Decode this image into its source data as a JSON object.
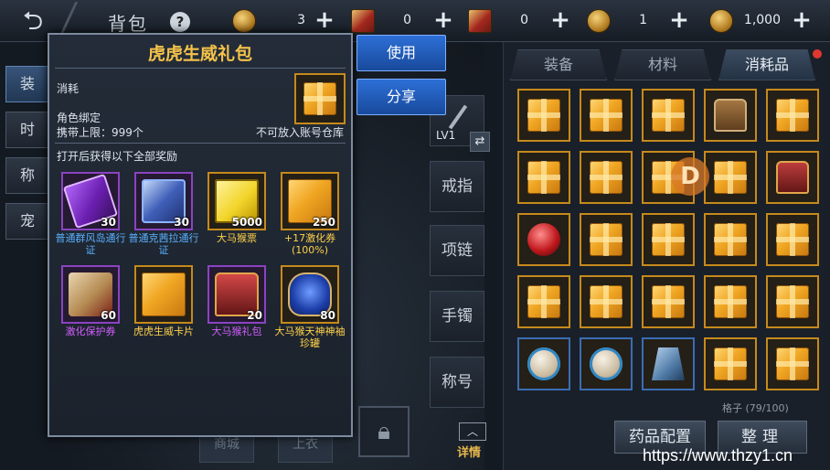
{
  "header": {
    "back_icon": "back-arrow-icon",
    "title": "背包",
    "help": "?",
    "currencies": [
      {
        "icon": "gold-coin-icon",
        "value": "3"
      },
      {
        "icon": "red-scroll-icon",
        "value": "0"
      },
      {
        "icon": "ticket-scroll-icon",
        "value": "0"
      },
      {
        "icon": "bronze-coin-icon",
        "value": "1"
      },
      {
        "icon": "gold-coin-stack-icon",
        "value": "1,000"
      }
    ],
    "plus": "+"
  },
  "left_categories": [
    "装",
    "时",
    "称",
    "宠"
  ],
  "equip_slots": [
    "LV1",
    "戒指",
    "项链",
    "手镯",
    "称号"
  ],
  "character": {
    "bottom_buttons": [
      "商城",
      "上衣"
    ],
    "detail_label": "详情",
    "detail_arrow": "︿"
  },
  "inventory": {
    "tabs": [
      "装备",
      "材料",
      "消耗品"
    ],
    "active_tab": "消耗品",
    "count_text": "格子 (79/100)",
    "medicine_button": "药品配置",
    "sort_button": "整理",
    "overlay_badge": "D",
    "cells": [
      "gift-box",
      "gift-box",
      "gift-box",
      "treasure-chest",
      "gift-box",
      "gift-box",
      "gift-box",
      "gift-box",
      "gift-box",
      "red-chest",
      "red-orb",
      "gift-box",
      "gift-box",
      "gift-box",
      "gift-box",
      "gift-box",
      "gift-box",
      "gift-box",
      "gift-box",
      "gift-box",
      "gift-ball",
      "gift-ball",
      "cape",
      "gift-box",
      "gift-box"
    ]
  },
  "popup": {
    "title": "虎虎生威礼包",
    "category": "消耗",
    "bind": "角色绑定",
    "limit": "携带上限：999个",
    "no_store": "不可放入账号仓库",
    "reward_header": "打开后获得以下全部奖励",
    "use_button": "使用",
    "share_button": "分享",
    "rewards": [
      {
        "name": "普通群风岛通行证",
        "count": "30",
        "frame": "purple",
        "name_color": "blue",
        "img": "ticket"
      },
      {
        "name": "普通克茜拉通行证",
        "count": "30",
        "frame": "purple",
        "name_color": "blue",
        "img": "scroll"
      },
      {
        "name": "大马猴票",
        "count": "5000",
        "frame": "gold",
        "name_color": "gold",
        "img": "tickets-yellow"
      },
      {
        "name": "+17激化券(100%)",
        "count": "250",
        "frame": "gold",
        "name_color": "gold",
        "img": "giftbox"
      },
      {
        "name": "激化保护券",
        "count": "60",
        "frame": "purple",
        "name_color": "purple",
        "img": "protect"
      },
      {
        "name": "虎虎生威卡片",
        "count": "",
        "frame": "gold",
        "name_color": "gold",
        "img": "giftbox"
      },
      {
        "name": "大马猴礼包",
        "count": "20",
        "frame": "purple",
        "name_color": "purple",
        "img": "redbox"
      },
      {
        "name": "大马猴天神神袖珍罐",
        "count": "80",
        "frame": "gold",
        "name_color": "gold",
        "img": "vase"
      }
    ]
  },
  "watermark": "https://www.thzy1.cn"
}
